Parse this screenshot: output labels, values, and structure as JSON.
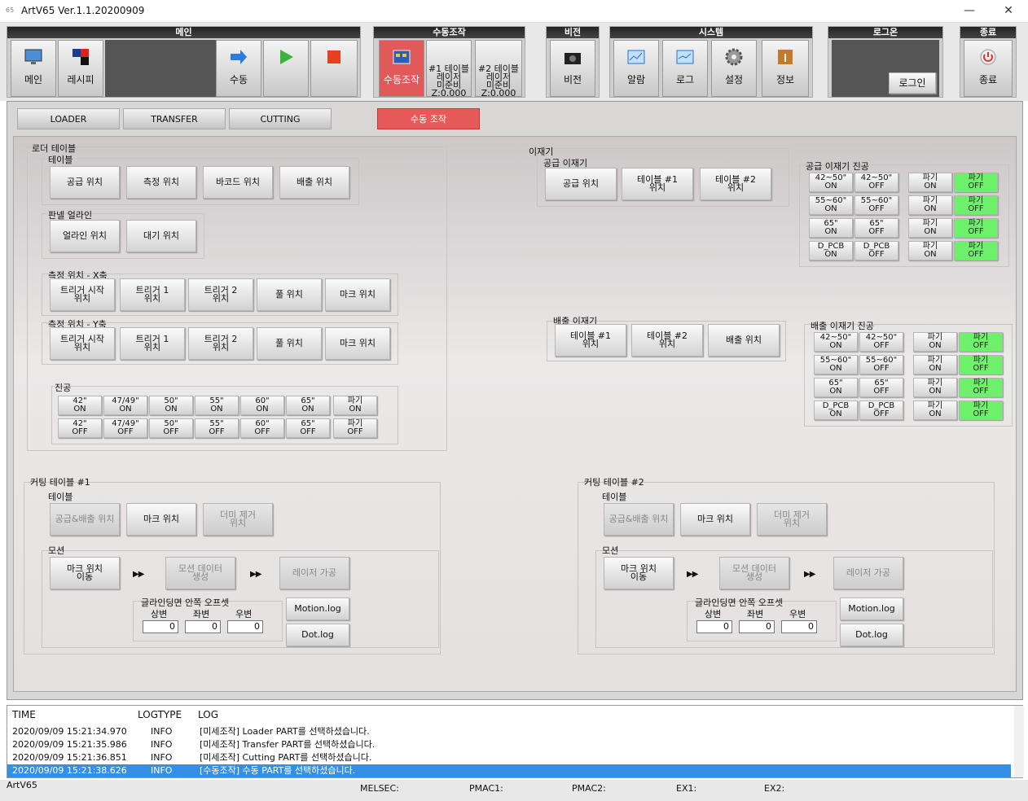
{
  "window": {
    "title": "ArtV65 Ver.1.1.20200909",
    "icon": "65",
    "min": "—",
    "max": "☐",
    "close": "✕"
  },
  "groups": {
    "main": "메인",
    "manual": "수동조작",
    "vision": "비전",
    "system": "시스템",
    "login": "로그온",
    "exit": "종료"
  },
  "toolbar": {
    "main": "메인",
    "recipe": "레시피",
    "manual": "수동",
    "manual_op": "수동조작",
    "laser1": "#1 테이블\n레이저\n미준비\nZ:0.000",
    "laser2": "#2 테이블\n레이저\n미준비\nZ:0.000",
    "vision": "비전",
    "alarm": "알람",
    "log": "로그",
    "settings": "설정",
    "info": "정보",
    "login": "로그인",
    "exit": "종료"
  },
  "tabs": {
    "loader": "LOADER",
    "transfer": "TRANSFER",
    "cutting": "CUTTING",
    "manual": "수동 조작"
  },
  "loader": {
    "title": "로더 테이블",
    "table": "테이블",
    "supply": "공급 위치",
    "measure": "측정 위치",
    "barcode": "바코드 위치",
    "discharge": "배출 위치",
    "panel": "판넬 얼라인",
    "align": "얼라인 위치",
    "wait": "대기 위치",
    "mx": "측정 위치 - X축",
    "my": "측정 위치 - Y축",
    "trig_start": "트리거 시작\n위치",
    "trig1": "트리거 1\n위치",
    "trig2": "트리거 2\n위치",
    "pool": "풀 위치",
    "mark": "마크 위치",
    "vac": "진공",
    "vac_on": [
      "42\"\nON",
      "47/49\"\nON",
      "50\"\nON",
      "55\"\nON",
      "60\"\nON",
      "65\"\nON",
      "파기\nON"
    ],
    "vac_off": [
      "42\"\nOFF",
      "47/49\"\nOFF",
      "50\"\nOFF",
      "55\"\nOFF",
      "60\"\nOFF",
      "65\"\nOFF",
      "파기\nOFF"
    ]
  },
  "transfer": {
    "title": "이재기",
    "supply": "공급 이재기",
    "supply_pos": "공급 위치",
    "t1": "테이블 #1\n위치",
    "t2": "테이블 #2\n위치",
    "discharge": "배출 이재기",
    "discharge_pos": "배출 위치",
    "svac": "공급 이재기 진공",
    "dvac": "배출 이재기 진공",
    "vac_rows": [
      [
        "42~50\"\nON",
        "42~50\"\nOFF",
        "파기\nON",
        "파기\nOFF"
      ],
      [
        "55~60\"\nON",
        "55~60\"\nOFF",
        "파기\nON",
        "파기\nOFF"
      ],
      [
        "65\"\nON",
        "65\"\nOFF",
        "파기\nON",
        "파기\nOFF"
      ],
      [
        "D_PCB\nON",
        "D_PCB\nOFF",
        "파기\nON",
        "파기\nOFF"
      ]
    ]
  },
  "cut1": {
    "title": "커팅 테이블 #1",
    "table": "테이블",
    "supply": "공급&배출 위치",
    "mark": "마크 위치",
    "dummy": "더미 제거\n위치",
    "motion": "모션",
    "move": "마크 위치\n이동",
    "gen": "모션 데이터\n생성",
    "laser": "레이저 가공",
    "arrows": "▶▶",
    "offset": "글라인딩면 안쪽 오프셋",
    "top": "상변",
    "left": "좌변",
    "right": "우변",
    "v_top": "0",
    "v_left": "0",
    "v_right": "0",
    "motion_log": "Motion.log",
    "dot_log": "Dot.log"
  },
  "cut2": {
    "title": "커팅 테이블 #2",
    "table": "테이블",
    "supply": "공급&배출 위치",
    "mark": "마크 위치",
    "dummy": "더미 제거\n위치",
    "motion": "모션",
    "move": "마크 위치\n이동",
    "gen": "모션 데이터\n생성",
    "laser": "레이저 가공",
    "arrows": "▶▶",
    "offset": "글라인딩면 안쪽 오프셋",
    "top": "상변",
    "left": "좌변",
    "right": "우변",
    "v_top": "0",
    "v_left": "0",
    "v_right": "0",
    "motion_log": "Motion.log",
    "dot_log": "Dot.log"
  },
  "log": {
    "h_time": "TIME",
    "h_type": "LOGTYPE",
    "h_log": "LOG",
    "rows": [
      {
        "t": "2020/09/09 15:21:34.970",
        "ty": "INFO",
        "m": "[미세조작] Loader PART를 선택하셨습니다."
      },
      {
        "t": "2020/09/09 15:21:35.986",
        "ty": "INFO",
        "m": "[미세조작] Transfer PART를 선택하셨습니다."
      },
      {
        "t": "2020/09/09 15:21:36.851",
        "ty": "INFO",
        "m": "[미세조작] Cutting PART를 선택하셨습니다."
      },
      {
        "t": "2020/09/09 15:21:38.626",
        "ty": "INFO",
        "m": "[수동조작] 수동 PART를 선택하셨습니다."
      }
    ]
  },
  "status": {
    "app": "ArtV65",
    "melsec": "MELSEC:",
    "pmac1": "PMAC1:",
    "pmac2": "PMAC2:",
    "ex1": "EX1:",
    "ex2": "EX2:"
  }
}
